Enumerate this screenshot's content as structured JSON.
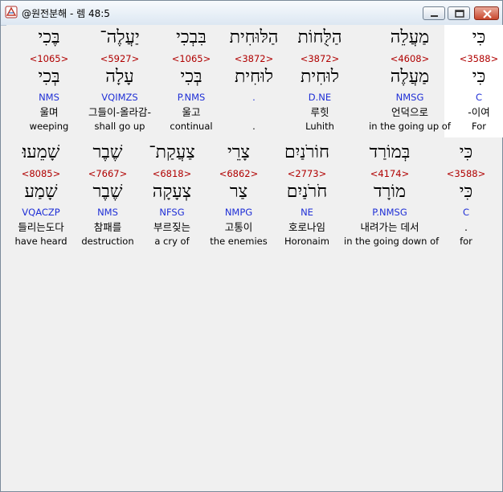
{
  "window": {
    "title": "@원전분해 - 렘 48:5",
    "icon": "app-bible-icon",
    "controls": [
      "minimize-icon",
      "maximize-icon",
      "close-icon"
    ]
  },
  "rows": [
    [
      {
        "hebrew": "כִּי",
        "strongs": "<3588>",
        "lemma": "כִּי",
        "parse": "C",
        "korean": "-이여",
        "english": "For",
        "highlight": true
      },
      {
        "hebrew": "מַעֲלֵה",
        "strongs": "<4608>",
        "lemma": "מַעֲלֶה",
        "parse": "NMSG",
        "korean": "언덕으로",
        "english": "in the going up of",
        "highlight": false
      },
      {
        "hebrew": "הַלֻּחוֹת",
        "strongs": "<3872>",
        "lemma": "לוּחִית",
        "parse": "D.NE",
        "korean": "루힛",
        "english": "Luhith",
        "highlight": false
      },
      {
        "hebrew": "הַלּוּחִית",
        "strongs": "<3872>",
        "lemma": "לוּחִית",
        "parse": ".",
        "korean": "",
        "english": ".",
        "highlight": false
      },
      {
        "hebrew": "בִּבְכִי",
        "strongs": "<1065>",
        "lemma": "בְּכִי",
        "parse": "P.NMS",
        "korean": "울고",
        "english": "continual",
        "highlight": false
      },
      {
        "hebrew": "יַעֲלֶה־",
        "strongs": "<5927>",
        "lemma": "עָלָה",
        "parse": "VQIMZS",
        "korean": "그들이-올라감-",
        "english": "shall go up",
        "highlight": false
      },
      {
        "hebrew": "בֶּכִי",
        "strongs": "<1065>",
        "lemma": "בְּכִי",
        "parse": "NMS",
        "korean": "울며",
        "english": "weeping",
        "highlight": false
      }
    ],
    [
      {
        "hebrew": "כִּי",
        "strongs": "<3588>",
        "lemma": "כִּי",
        "parse": "C",
        "korean": ".",
        "english": "for",
        "highlight": false
      },
      {
        "hebrew": "בְּמוֹרַד",
        "strongs": "<4174>",
        "lemma": "מוֹרָד",
        "parse": "P.NMSG",
        "korean": "내려가는 데서",
        "english": "in the going down of",
        "highlight": false
      },
      {
        "hebrew": "חוֹרֹנַיִם",
        "strongs": "<2773>",
        "lemma": "חֹרֹנַיִם",
        "parse": "NE",
        "korean": "호로나임",
        "english": "Horonaim",
        "highlight": false
      },
      {
        "hebrew": "צָרֵי",
        "strongs": "<6862>",
        "lemma": "צַר",
        "parse": "NMPG",
        "korean": "고통이",
        "english": "the enemies",
        "highlight": false
      },
      {
        "hebrew": "צַעֲקַת־",
        "strongs": "<6818>",
        "lemma": "צְעָקָה",
        "parse": "NFSG",
        "korean": "부르짖는",
        "english": "a cry of",
        "highlight": false
      },
      {
        "hebrew": "שֶׁבֶר",
        "strongs": "<7667>",
        "lemma": "שֶׁבֶר",
        "parse": "NMS",
        "korean": "참패를",
        "english": "destruction",
        "highlight": false
      },
      {
        "hebrew": "שָׁמֵעוּ׃",
        "strongs": "<8085>",
        "lemma": "שָׁמַע",
        "parse": "VQACZP",
        "korean": "들리는도다",
        "english": "have heard",
        "highlight": false
      }
    ]
  ]
}
